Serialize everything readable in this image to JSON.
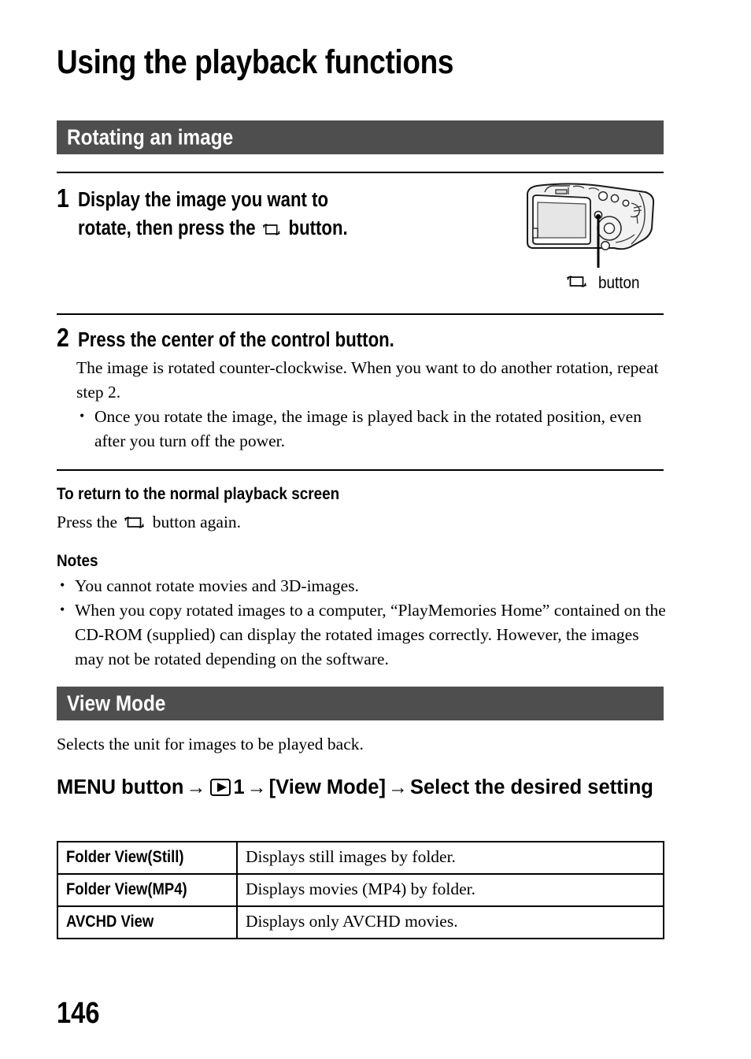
{
  "document": {
    "title": "Using the playback functions",
    "page_number": "146"
  },
  "sections": [
    {
      "bar_label": "Rotating an image",
      "steps": [
        {
          "number": "1",
          "heading_line1": "Display the image you want to",
          "heading_line2_before_icon": "rotate, then press the",
          "heading_icon": "rotate-icon",
          "heading_line2_after_icon": "button."
        },
        {
          "number": "2",
          "heading": "Press the center of the control button.",
          "paragraph": "The image is rotated counter-clockwise. When you want to do another rotation, repeat step 2.",
          "bullets": [
            "Once you rotate the image, the image is played back in the rotated position, even after you turn off the power."
          ]
        }
      ],
      "illustration": {
        "alt": "camera-rear-view",
        "caption_icon": "rotate-icon",
        "caption_text": "button"
      },
      "subsections": [
        {
          "heading": "To return to the normal playback screen",
          "text_before_icon": "Press the",
          "icon": "rotate-icon",
          "text_after_icon": "button again."
        },
        {
          "heading": "Notes",
          "bullets": [
            "You cannot rotate movies and 3D-images.",
            "When you copy rotated images to a computer, “PlayMemories Home” contained on the CD-ROM (supplied) can display the rotated images correctly. However, the images may not be rotated depending on the software."
          ]
        }
      ]
    },
    {
      "bar_label": "View Mode",
      "description": "Selects the unit for images to be played back.",
      "menu_path": {
        "seg1": "MENU button",
        "arrow1": "→",
        "icon": "playback-icon",
        "seg2": "1",
        "arrow2": "→",
        "seg3": "[View Mode]",
        "arrow3": "→",
        "seg4": "Select the desired setting"
      },
      "table": {
        "rows": [
          {
            "label": "Folder View(Still)",
            "description": "Displays still images by folder."
          },
          {
            "label": "Folder View(MP4)",
            "description": "Displays movies (MP4) by folder."
          },
          {
            "label": "AVCHD View",
            "description": "Displays only AVCHD movies."
          }
        ]
      }
    }
  ],
  "colors": {
    "section_bar_background": "#4e4e4e",
    "section_bar_text": "#ffffff",
    "page_background": "#ffffff",
    "text": "#000000"
  }
}
